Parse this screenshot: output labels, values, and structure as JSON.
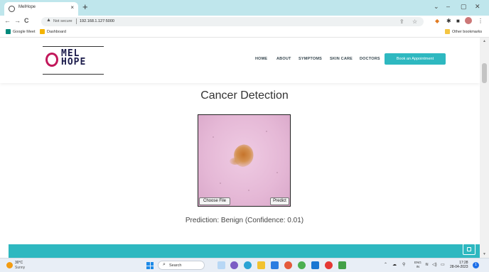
{
  "browser": {
    "tab_title": "MelHope",
    "tab_close": "×",
    "new_tab": "+",
    "window_controls": [
      "⌄",
      "–",
      "▢",
      "✕"
    ],
    "nav": {
      "back": "←",
      "forward": "→",
      "reload": "C"
    },
    "security_label": "Not secure",
    "url": "192.168.1.127:5000",
    "bookmarks": [
      {
        "label": "Google Meet",
        "icon": "google-meet-icon",
        "color": "#00897b"
      },
      {
        "label": "Dashboard",
        "icon": "dashboard-icon",
        "color": "#f4b400"
      }
    ],
    "other_bookmarks": "Other bookmarks"
  },
  "site": {
    "logo_letter": "O",
    "logo_line1": "MEL",
    "logo_line2": "HOPE",
    "nav_links": [
      "HOME",
      "ABOUT",
      "SYMPTOMS",
      "SKIN CARE",
      "DOCTORS"
    ],
    "cta_button": "Book an Appointment",
    "accent_color": "#2eb8c0",
    "page_title": "Cancer Detection",
    "choose_file_label": "Choose File",
    "predict_label": "Predict",
    "prediction_text": "Prediction: Benign (Confidence: 0.01)"
  },
  "taskbar": {
    "weather_temp": "30°C",
    "weather_condition": "Sunny",
    "search_label": "Search",
    "language": "ENG",
    "region": "IN",
    "time": "17:28",
    "date": "28-04-2023",
    "notification_count": "1"
  }
}
